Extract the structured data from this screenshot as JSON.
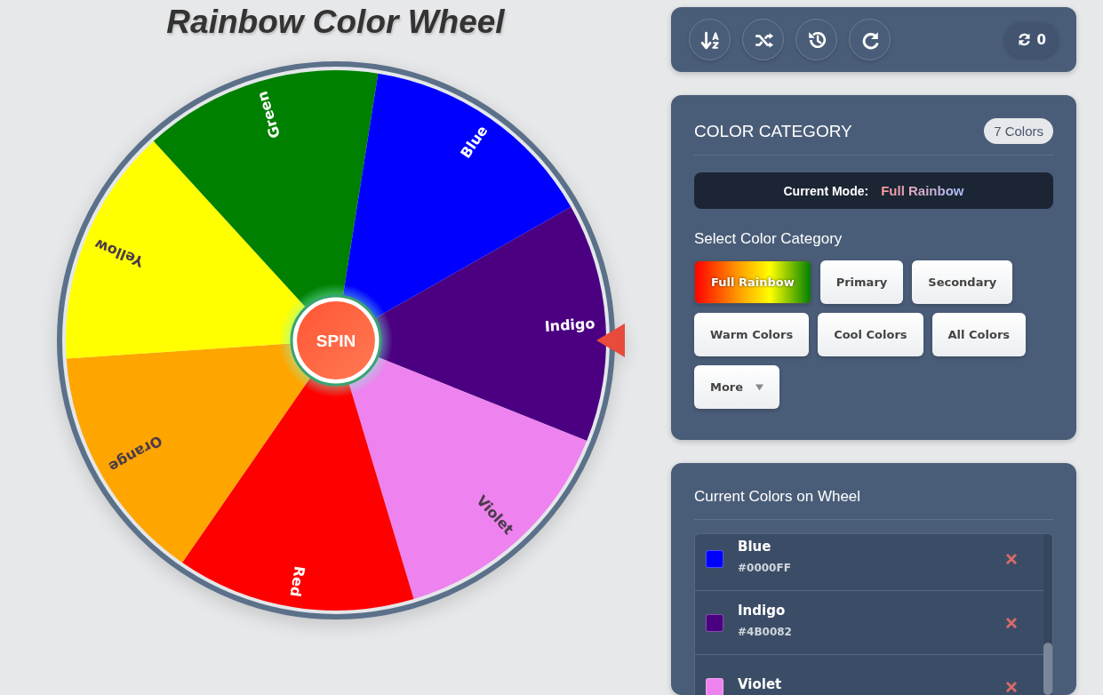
{
  "title": "Rainbow Color Wheel",
  "wheel": {
    "spin_label": "SPIN",
    "segments": [
      {
        "label": "Indigo",
        "color": "#4b0082"
      },
      {
        "label": "Violet",
        "color": "#ee82ee"
      },
      {
        "label": "Red",
        "color": "#ff0000"
      },
      {
        "label": "Orange",
        "color": "#ffa500"
      },
      {
        "label": "Yellow",
        "color": "#ffff00"
      },
      {
        "label": "Green",
        "color": "#008000"
      },
      {
        "label": "Blue",
        "color": "#0000ff"
      }
    ]
  },
  "toolbar": {
    "buttons": [
      {
        "kind": "sort"
      },
      {
        "kind": "shuffle"
      },
      {
        "kind": "history"
      },
      {
        "kind": "redo"
      }
    ],
    "spin_count": "0"
  },
  "category_panel": {
    "title": "COLOR CATEGORY",
    "count_badge": "7 Colors",
    "mode_label": "Current Mode:",
    "mode_value": "Full Rainbow",
    "select_label": "Select Color Category",
    "categories": [
      {
        "label": "Full Rainbow",
        "selected": true,
        "kind": "option"
      },
      {
        "label": "Primary",
        "selected": false,
        "kind": "option"
      },
      {
        "label": "Secondary",
        "selected": false,
        "kind": "option"
      },
      {
        "label": "Warm Colors",
        "selected": false,
        "kind": "option"
      },
      {
        "label": "Cool Colors",
        "selected": false,
        "kind": "option"
      },
      {
        "label": "All Colors",
        "selected": false,
        "kind": "option"
      },
      {
        "label": "More",
        "selected": false,
        "kind": "dropdown"
      }
    ]
  },
  "colors_panel": {
    "title": "Current Colors on Wheel",
    "items": [
      {
        "name": "Blue",
        "hex": "#0000FF",
        "color": "#0000ff"
      },
      {
        "name": "Indigo",
        "hex": "#4B0082",
        "color": "#4b0082"
      },
      {
        "name": "Violet",
        "color": "#ee82ee"
      }
    ]
  }
}
